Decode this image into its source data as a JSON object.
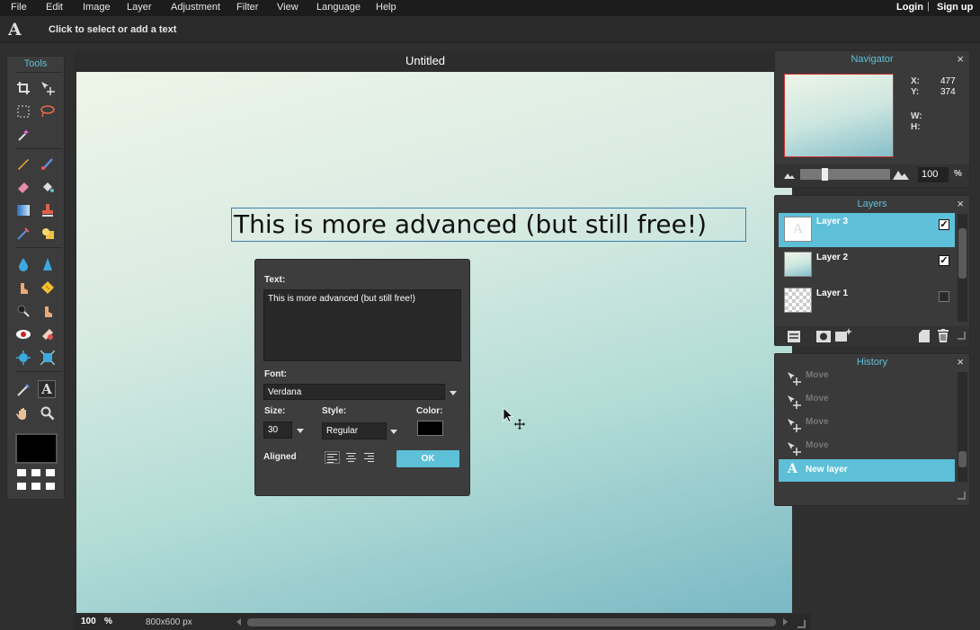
{
  "menu": [
    "File",
    "Edit",
    "Image",
    "Layer",
    "Adjustment",
    "Filter",
    "View",
    "Language",
    "Help"
  ],
  "auth": {
    "login": "Login",
    "separator": "|",
    "signup": "Sign up"
  },
  "options_bar": {
    "tool_glyph": "A",
    "hint": "Click to select or add a text"
  },
  "tools_panel": {
    "title": "Tools",
    "foreground_color": "#000000"
  },
  "document": {
    "title": "Untitled",
    "canvas_text": "This is more advanced (but still free!)",
    "zoom": "100",
    "zoom_unit": "%",
    "dimensions": "800x600 px"
  },
  "text_dialog": {
    "text_label": "Text:",
    "text_value": "This is more advanced (but still free!)",
    "font_label": "Font:",
    "font_value": "Verdana",
    "size_label": "Size:",
    "size_value": "30",
    "style_label": "Style:",
    "style_value": "Regular",
    "color_label": "Color:",
    "color_value": "#000000",
    "aligned_label": "Aligned",
    "ok_label": "OK"
  },
  "navigator": {
    "title": "Navigator",
    "close": "×",
    "x_label": "X:",
    "x_value": "477",
    "y_label": "Y:",
    "y_value": "374",
    "w_label": "W:",
    "h_label": "H:",
    "zoom_value": "100",
    "zoom_unit": "%"
  },
  "layers": {
    "title": "Layers",
    "close": "×",
    "items": [
      {
        "name": "Layer 3",
        "visible": true,
        "selected": true
      },
      {
        "name": "Layer 2",
        "visible": true,
        "selected": false
      },
      {
        "name": "Layer 1",
        "visible": false,
        "selected": false
      }
    ]
  },
  "history": {
    "title": "History",
    "close": "×",
    "items": [
      {
        "label": "Move",
        "selected": false
      },
      {
        "label": "Move",
        "selected": false
      },
      {
        "label": "Move",
        "selected": false
      },
      {
        "label": "Move",
        "selected": false
      },
      {
        "label": "New layer",
        "selected": true
      }
    ]
  },
  "colors": {
    "accent": "#5ec0d8",
    "panel_bg": "#3a3a3a",
    "app_bg": "#2f2f2f"
  }
}
